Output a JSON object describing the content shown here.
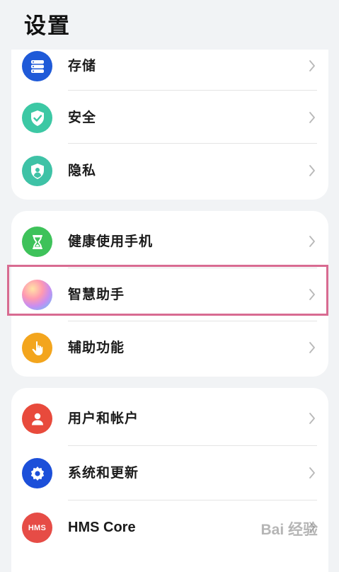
{
  "page": {
    "title": "设置"
  },
  "colors": {
    "storage": "#1f5ad8",
    "security": "#3cc8a4",
    "privacy": "#3ec2a6",
    "digital_balance": "#3ec25a",
    "assistant": "gradient",
    "accessibility": "#f3a51d",
    "users": "#e84a3c",
    "system": "#1c4fd9",
    "hms": "#e64c46",
    "highlight": "#d86b91"
  },
  "groups": [
    {
      "items": [
        {
          "label": "存储",
          "icon": "storage-icon"
        },
        {
          "label": "安全",
          "icon": "shield-check-icon"
        },
        {
          "label": "隐私",
          "icon": "privacy-shield-icon"
        }
      ]
    },
    {
      "items": [
        {
          "label": "健康使用手机",
          "icon": "hourglass-icon"
        },
        {
          "label": "智慧助手",
          "icon": "assistant-orb-icon"
        },
        {
          "label": "辅助功能",
          "icon": "hand-pointer-icon"
        }
      ]
    },
    {
      "items": [
        {
          "label": "用户和帐户",
          "icon": "user-icon"
        },
        {
          "label": "系统和更新",
          "icon": "gear-icon"
        },
        {
          "label": "HMS Core",
          "icon": "hms-icon",
          "icon_text": "HMS"
        }
      ]
    }
  ],
  "watermark": {
    "text": "Bai 经验"
  }
}
